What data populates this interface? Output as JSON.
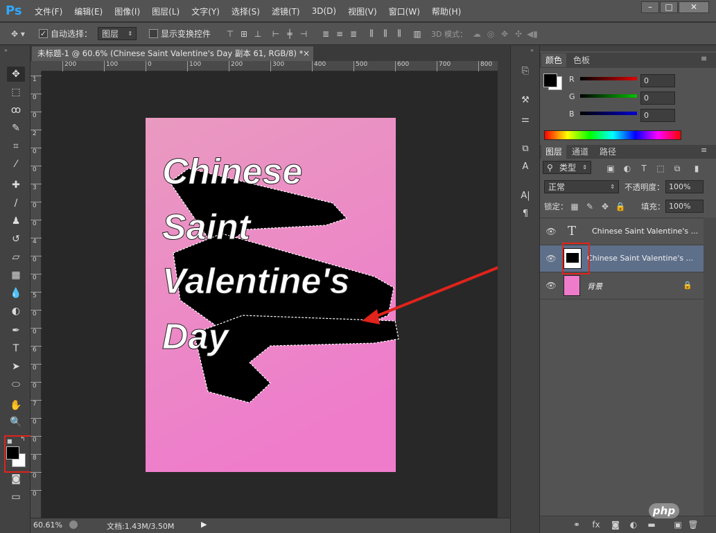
{
  "app": {
    "logo": "Ps"
  },
  "menu": [
    "文件(F)",
    "编辑(E)",
    "图像(I)",
    "图层(L)",
    "文字(Y)",
    "选择(S)",
    "滤镜(T)",
    "3D(D)",
    "视图(V)",
    "窗口(W)",
    "帮助(H)"
  ],
  "window_controls": {
    "minimize": "–",
    "maximize": "□",
    "close": "✕"
  },
  "options": {
    "auto_select_label": "自动选择：",
    "auto_select_target": "图层",
    "show_transform_label": "显示变换控件",
    "mode_3d_label": "3D 模式："
  },
  "document": {
    "tab_title": "未标题-1 @ 60.6% (Chinese  Saint  Valentine's  Day 副本 61, RGB/8) *",
    "close": "×",
    "bg_gradient_top": "#e99ac0",
    "bg_gradient_bottom": "#ee7ccb",
    "text_lines": [
      "Chinese",
      "Saint",
      "Valentine's",
      "Day"
    ]
  },
  "ruler": {
    "h_ticks": [
      "200",
      "100",
      "0",
      "100",
      "200",
      "300",
      "400",
      "500",
      "600",
      "700",
      "800"
    ],
    "v_ticks": [
      "1",
      "0",
      "0",
      "2",
      "0",
      "0",
      "3",
      "0",
      "0",
      "4",
      "0",
      "0",
      "5",
      "0",
      "0",
      "6",
      "0",
      "0",
      "7",
      "0",
      "0",
      "8",
      "0",
      "0"
    ]
  },
  "status": {
    "zoom": "60.61%",
    "doc_info": "文档:1.43M/3.50M"
  },
  "colors": {
    "foreground": "#000000",
    "background": "#ffffff",
    "accent_red": "#e0231b"
  },
  "color_panel": {
    "tabs": [
      "颜色",
      "色板"
    ],
    "channels": [
      {
        "name": "R",
        "value": "0",
        "color": "#e00000"
      },
      {
        "name": "G",
        "value": "0",
        "color": "#00c000"
      },
      {
        "name": "B",
        "value": "0",
        "color": "#0000d0"
      }
    ]
  },
  "layers_panel": {
    "tabs": [
      "图层",
      "通道",
      "路径"
    ],
    "filter_label": "类型",
    "blend_mode": "正常",
    "opacity_label": "不透明度：",
    "opacity_value": "100%",
    "lock_label": "锁定：",
    "fill_label": "填充：",
    "fill_value": "100%",
    "layers": [
      {
        "name": "Chinese  Saint  Valentine's ...",
        "kind": "text"
      },
      {
        "name": "Chinese  Saint  Valentine's ...",
        "kind": "raster"
      },
      {
        "name": "背景",
        "kind": "background"
      }
    ],
    "bottom_icons": [
      "link-icon",
      "fx-icon",
      "mask-icon",
      "adjustment-icon",
      "folder-icon",
      "new-layer-icon",
      "trash-icon"
    ]
  },
  "watermark": "php"
}
